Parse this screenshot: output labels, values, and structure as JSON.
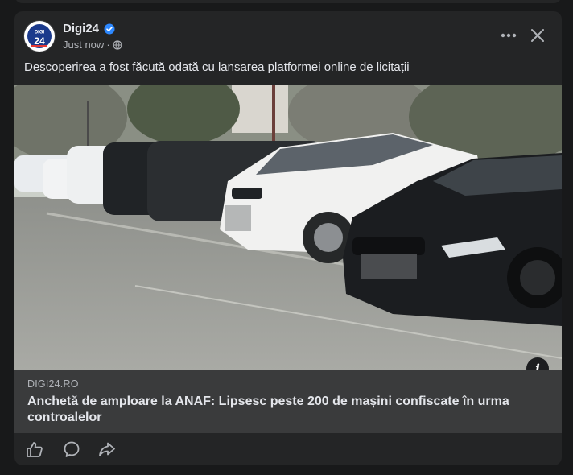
{
  "post": {
    "page_name": "Digi24",
    "timestamp": "Just now",
    "separator": "·",
    "privacy_icon": "globe-icon",
    "verified_icon": "verified-badge-icon",
    "more_icon": "more-options-icon",
    "close_icon": "close-icon",
    "caption": "Descoperirea a fost făcută odată cu lansarea platformei online de licitații",
    "avatar_text": "DIGI 24"
  },
  "link": {
    "domain": "DIGI24.RO",
    "headline": "Anchetă de amploare la ANAF: Lipsesc peste 200 de mașini confiscate în urma controalelor",
    "info_label": "i"
  },
  "actions": [
    {
      "name": "like-button",
      "icon": "thumbs-up-icon"
    },
    {
      "name": "comment-button",
      "icon": "comment-icon"
    },
    {
      "name": "share-button",
      "icon": "share-icon"
    }
  ],
  "colors": {
    "background": "#18191a",
    "card": "#242526",
    "link_panel": "#3a3b3c",
    "verified": "#2d88ff",
    "primary_text": "#e4e6eb",
    "secondary_text": "#b0b3b8"
  }
}
